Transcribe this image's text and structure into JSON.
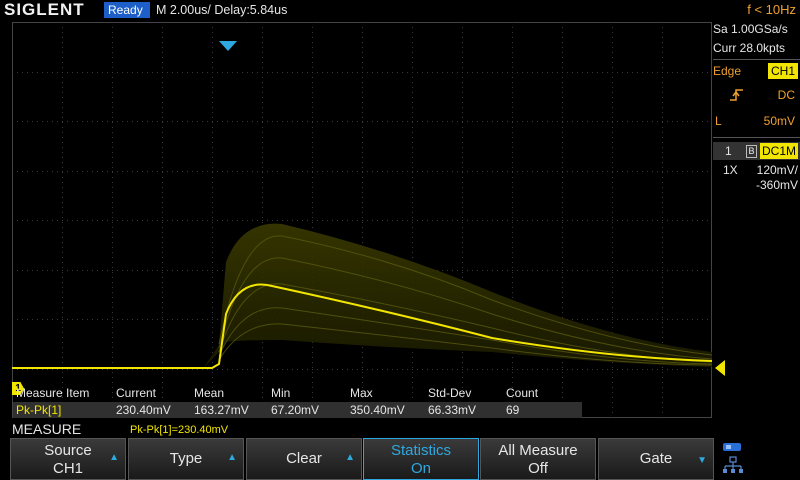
{
  "topbar": {
    "logo": "SIGLENT",
    "status": "Ready",
    "timebase": "M 2.00us/  Delay:5.84us",
    "frequency": "f < 10Hz"
  },
  "channel_marker": "1",
  "measure_table": {
    "headers": [
      "Measure Item",
      "Current",
      "Mean",
      "Min",
      "Max",
      "Std-Dev",
      "Count"
    ],
    "row": [
      "Pk-Pk[1]",
      "230.40mV",
      "163.27mV",
      "67.20mV",
      "350.40mV",
      "66.33mV",
      "69"
    ]
  },
  "right_panel": {
    "sample_rate": "Sa 1.00GSa/s",
    "memory": "Curr 28.0kpts",
    "trigger_type": "Edge",
    "trigger_source": "CH1",
    "trigger_coupling": "DC",
    "trigger_level_label": "L",
    "trigger_level": "50mV",
    "channel_number": "1",
    "bandwidth_flag": "B",
    "channel_coupling": "DC1M",
    "probe": "1X",
    "volts_div": "120mV/",
    "offset": "-360mV"
  },
  "menu": {
    "title": "MEASURE",
    "message": "Pk-Pk[1]=230.40mV",
    "softkeys": [
      {
        "line1": "Source",
        "line2": "CH1"
      },
      {
        "line1": "Type",
        "line2": ""
      },
      {
        "line1": "Clear",
        "line2": ""
      },
      {
        "line1": "Statistics",
        "line2": "On"
      },
      {
        "line1": "All Measure",
        "line2": "Off"
      },
      {
        "line1": "Gate",
        "line2": ""
      }
    ]
  },
  "colors": {
    "trace": "#f2e600",
    "accent": "#2ea8e0",
    "status": "#1e5ec8",
    "trigger_info": "#f0a030"
  },
  "icons": [
    "trigger-position-icon",
    "rising-edge-icon",
    "network-icon",
    "usb-icon"
  ]
}
